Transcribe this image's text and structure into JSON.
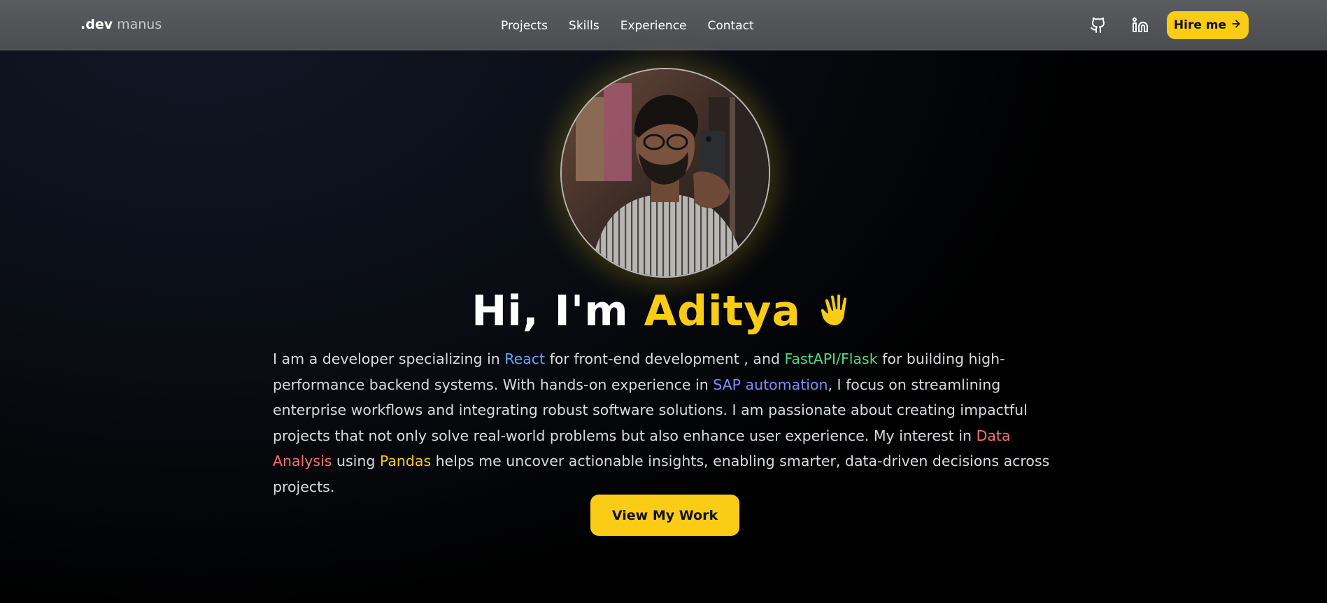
{
  "navbar": {
    "brand_dev": ".dev",
    "brand_name": "manus",
    "links": [
      "Projects",
      "Skills",
      "Experience",
      "Contact"
    ],
    "github_icon": "github-icon",
    "linkedin_icon": "linkedin-icon",
    "hire_label": "Hire me",
    "hire_icon": "arrow-right-icon"
  },
  "hero": {
    "greeting": "Hi, I'm",
    "name": "Aditya",
    "wave_icon": "waving-hand-icon",
    "bio": {
      "p1": "I am a developer specializing in ",
      "react": "React",
      "p2": " for front-end development , and ",
      "flask": "FastAPI/Flask",
      "p3": " for building high-performance backend systems. With hands-on experience in ",
      "sap": "SAP automation",
      "p4": ", I focus on streamlining enterprise workflows and integrating robust software solutions. I am passionate about creating impactful projects that not only solve real-world problems but also enhance user experience. My interest in ",
      "data": "Data Analysis",
      "p5": " using ",
      "pandas": "Pandas",
      "p6": " helps me uncover actionable insights, enabling smarter, data-driven decisions across projects."
    },
    "cta_label": "View My Work"
  },
  "colors": {
    "accent": "#facc15",
    "react": "#60a5fa",
    "flask": "#4ade80",
    "sap": "#818cf8",
    "data_analysis": "#f87171",
    "pandas": "#facc15"
  }
}
